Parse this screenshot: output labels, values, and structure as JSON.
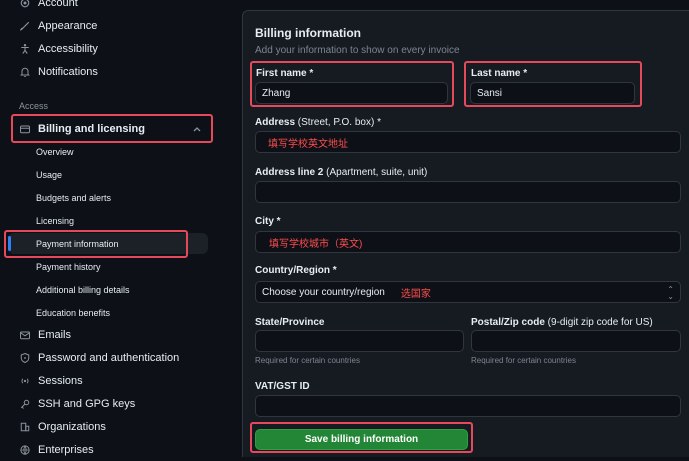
{
  "sidebar": {
    "top_items": [
      {
        "label": "Account",
        "icon": "gear-icon"
      },
      {
        "label": "Appearance",
        "icon": "paintbrush-icon"
      },
      {
        "label": "Accessibility",
        "icon": "accessibility-icon"
      },
      {
        "label": "Notifications",
        "icon": "bell-icon"
      }
    ],
    "section_access": "Access",
    "billing": {
      "label": "Billing and licensing",
      "icon": "credit-card-icon",
      "expanded": true
    },
    "billing_sub": [
      "Overview",
      "Usage",
      "Budgets and alerts",
      "Licensing",
      "Payment information",
      "Payment history",
      "Additional billing details",
      "Education benefits"
    ],
    "active_sub": "Payment information",
    "bottom_items": [
      {
        "label": "Emails",
        "icon": "mail-icon"
      },
      {
        "label": "Password and authentication",
        "icon": "shield-lock-icon"
      },
      {
        "label": "Sessions",
        "icon": "broadcast-icon"
      },
      {
        "label": "SSH and GPG keys",
        "icon": "key-icon"
      },
      {
        "label": "Organizations",
        "icon": "organization-icon"
      },
      {
        "label": "Enterprises",
        "icon": "globe-icon"
      }
    ]
  },
  "form": {
    "title": "Billing information",
    "subtitle": "Add your information to show on every invoice",
    "first_name": {
      "label": "First name *",
      "value": "Zhang"
    },
    "last_name": {
      "label": "Last name *",
      "value": "Sansi"
    },
    "address": {
      "label": "Address",
      "note": " (Street, P.O. box) *",
      "value": "填写学校英文地址"
    },
    "address2": {
      "label": "Address line 2",
      "note": " (Apartment, suite, unit)",
      "value": ""
    },
    "city": {
      "label": "City *",
      "value": "填写学校城市（英文)"
    },
    "country": {
      "label": "Country/Region *",
      "value": "Choose your country/region",
      "annotation": "选国家"
    },
    "state": {
      "label": "State/Province",
      "value": "",
      "hint": "Required for certain countries"
    },
    "postal": {
      "label": "Postal/Zip code",
      "note": " (9-digit zip code for US)",
      "value": "",
      "hint": "Required for certain countries"
    },
    "vat": {
      "label": "VAT/GST ID",
      "value": ""
    },
    "save_label": "Save billing information"
  },
  "colors": {
    "accent": "#2f81f7",
    "highlight": "#e5495a",
    "save": "#238636",
    "annotation": "#ff4d4d"
  }
}
